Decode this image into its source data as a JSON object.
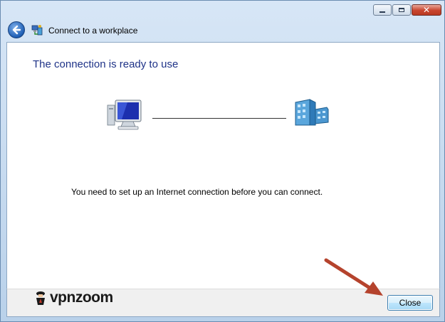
{
  "window": {
    "title": "Connect to a workplace",
    "caption_buttons": [
      "minimize-icon",
      "maximize-icon",
      "close-icon"
    ]
  },
  "main": {
    "heading": "The connection is ready to use",
    "message": "You need to set up an Internet connection before you can connect."
  },
  "footer": {
    "brand": "vpnzoom",
    "close_label": "Close"
  },
  "colors": {
    "heading": "#1e3287",
    "arrow": "#b5432d"
  }
}
